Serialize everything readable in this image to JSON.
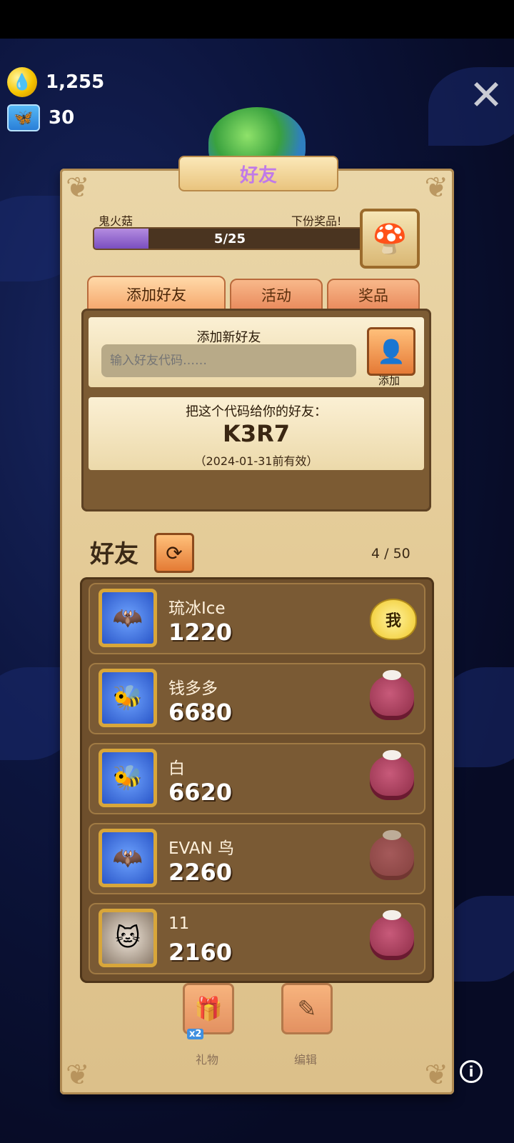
{
  "currency": {
    "gold_value": "1,255",
    "butterfly_value": "30"
  },
  "header": {
    "title": "好友"
  },
  "progress": {
    "left_label": "鬼火菇",
    "right_label": "下份奖品!",
    "text": "5/25",
    "fraction": 0.2
  },
  "tabs": [
    {
      "label": "添加好友",
      "active": true
    },
    {
      "label": "活动",
      "active": false
    },
    {
      "label": "奖品",
      "active": false
    }
  ],
  "add_friend": {
    "title": "添加新好友",
    "input_placeholder": "输入好友代码……",
    "add_label": "添加"
  },
  "share_code": {
    "title": "把这个代码给你的好友：",
    "code": "K3R7",
    "valid": "（2024-01-31前有效）"
  },
  "friends": {
    "title": "好友",
    "count": "4 / 50",
    "list": [
      {
        "name": "琉冰Ice",
        "score": "1220",
        "avatar": "bat-icon",
        "action": "me",
        "badge": "我"
      },
      {
        "name": "钱多多",
        "score": "6680",
        "avatar": "bee-icon",
        "action": "gift"
      },
      {
        "name": "白",
        "score": "6620",
        "avatar": "bee-icon",
        "action": "gift"
      },
      {
        "name": "EVAN 鸟",
        "score": "2260",
        "avatar": "bat-icon",
        "action": "gift-faded"
      },
      {
        "name": "11",
        "score": "2160",
        "avatar": "cat-icon",
        "action": "gift"
      }
    ]
  },
  "bottom": {
    "gift_label": "礼物",
    "gift_multiplier": "x2",
    "edit_label": "编辑"
  },
  "colors": {
    "accent": "#e98a5c",
    "panel": "#e3c994",
    "progress": "#7a4ec0"
  }
}
